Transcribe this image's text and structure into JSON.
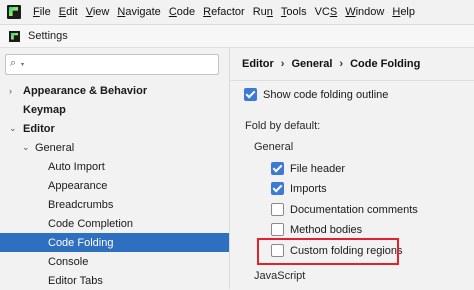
{
  "menubar": {
    "items": [
      {
        "label": "File",
        "mnemonic": "F",
        "rest": "ile"
      },
      {
        "label": "Edit",
        "mnemonic": "E",
        "rest": "dit"
      },
      {
        "label": "View",
        "mnemonic": "V",
        "rest": "iew"
      },
      {
        "label": "Navigate",
        "mnemonic": "N",
        "rest": "avigate"
      },
      {
        "label": "Code",
        "mnemonic": "C",
        "rest": "ode"
      },
      {
        "label": "Refactor",
        "mnemonic": "R",
        "rest": "efactor"
      },
      {
        "label": "Run",
        "mnemonic": "",
        "rest": "Ru",
        "tail_mnemonic": "n"
      },
      {
        "label": "Tools",
        "mnemonic": "T",
        "rest": "ools"
      },
      {
        "label": "VCS",
        "mnemonic": "",
        "rest": "VC",
        "tail_mnemonic": "S"
      },
      {
        "label": "Window",
        "mnemonic": "W",
        "rest": "indow"
      },
      {
        "label": "Help",
        "mnemonic": "H",
        "rest": "elp"
      }
    ]
  },
  "titlebar": {
    "title": "Settings"
  },
  "sidebar": {
    "search": {
      "value": "",
      "placeholder": ""
    },
    "items": [
      {
        "label": "Appearance & Behavior",
        "bold": true,
        "arrow": "right"
      },
      {
        "label": "Keymap",
        "bold": true,
        "arrow": ""
      },
      {
        "label": "Editor",
        "bold": true,
        "arrow": "down"
      },
      {
        "label": "General",
        "bold": false,
        "arrow": "down"
      },
      {
        "label": "Auto Import",
        "bold": false,
        "arrow": ""
      },
      {
        "label": "Appearance",
        "bold": false,
        "arrow": ""
      },
      {
        "label": "Breadcrumbs",
        "bold": false,
        "arrow": ""
      },
      {
        "label": "Code Completion",
        "bold": false,
        "arrow": ""
      },
      {
        "label": "Code Folding",
        "bold": false,
        "arrow": "",
        "selected": true
      },
      {
        "label": "Console",
        "bold": false,
        "arrow": ""
      },
      {
        "label": "Editor Tabs",
        "bold": false,
        "arrow": ""
      }
    ]
  },
  "content": {
    "breadcrumb": [
      "Editor",
      "General",
      "Code Folding"
    ],
    "breadcrumb_sep": "›",
    "show_outline": {
      "label": "Show code folding outline",
      "checked": true
    },
    "fold_by_default": "Fold by default:",
    "general_heading": "General",
    "options": [
      {
        "label": "File header",
        "checked": true
      },
      {
        "label": "Imports",
        "checked": true
      },
      {
        "label": "Documentation comments",
        "checked": false
      },
      {
        "label": "Method bodies",
        "checked": false
      },
      {
        "label": "Custom folding regions",
        "checked": false
      }
    ],
    "javascript_heading": "JavaScript",
    "highlight_color": "#e4202c"
  }
}
